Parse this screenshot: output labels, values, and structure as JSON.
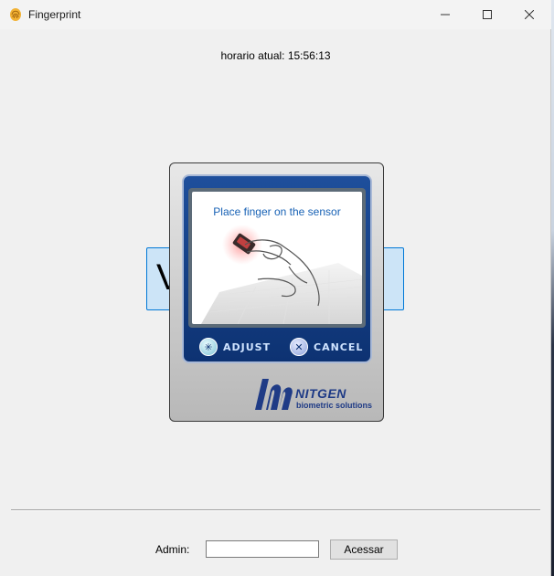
{
  "window": {
    "title": "Fingerprint",
    "icon": "fingerprint-icon",
    "controls": [
      "minimize-icon",
      "maximize-icon",
      "close-icon"
    ]
  },
  "clock": {
    "text": "horario atual: 15:56:13"
  },
  "background_button": {
    "visible_text": "V                  l"
  },
  "sensor_dialog": {
    "message": "Place finger on the sensor",
    "adjust_label": "ADJUST",
    "cancel_label": "CANCEL",
    "brand_name": "NITGEN",
    "brand_tagline": "biometric solutions",
    "colors": {
      "frame": "#0d3272",
      "message": "#1761b5",
      "brand": "#1f3b86"
    }
  },
  "footer": {
    "admin_label": "Admin:",
    "admin_value": "",
    "access_button": "Acessar"
  }
}
